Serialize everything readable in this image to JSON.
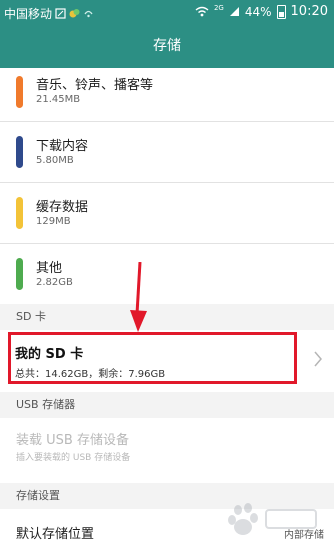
{
  "status_bar": {
    "carrier": "中国移动",
    "network": "2G",
    "battery": "44%",
    "time": "10:20",
    "icons": [
      "sim-icon",
      "notification-icon",
      "wifi-icon",
      "signal-icon",
      "battery-icon"
    ]
  },
  "header": {
    "title": "存储"
  },
  "categories": [
    {
      "name": "音乐、铃声、播客等",
      "size": "21.45MB",
      "color": "#f07a2c"
    },
    {
      "name": "下载内容",
      "size": "5.80MB",
      "color": "#2f4a8c"
    },
    {
      "name": "缓存数据",
      "size": "129MB",
      "color": "#f3c338"
    },
    {
      "name": "其他",
      "size": "2.82GB",
      "color": "#4eab4f"
    }
  ],
  "sd_section": {
    "header": "SD 卡",
    "item_title": "我的 SD 卡",
    "item_detail": "总共：14.62GB，剩余：7.96GB"
  },
  "usb_section": {
    "header": "USB 存储器",
    "item_title": "装载 USB 存储设备",
    "item_subtitle": "插入要装载的 USB 存储设备"
  },
  "settings_section": {
    "header": "存储设置",
    "default_location_label": "默认存储位置",
    "default_location_value": "内部存储"
  },
  "annotation": {
    "highlight_color": "#e1182a"
  },
  "colors": {
    "accent": "#2c8f84"
  }
}
